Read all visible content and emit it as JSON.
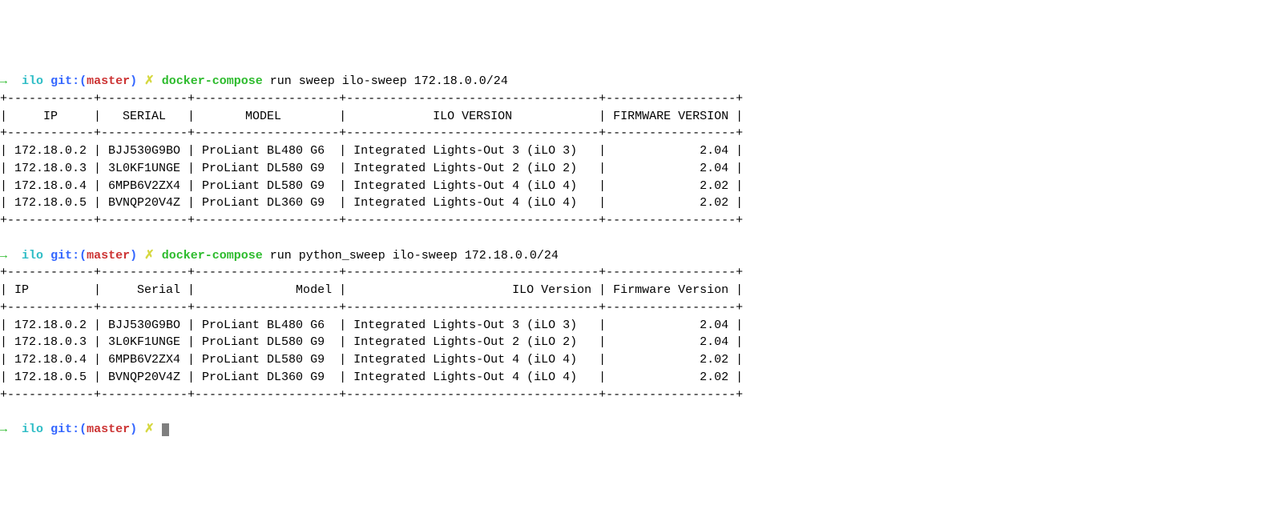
{
  "prompts": [
    {
      "arrow": "→",
      "dir": "ilo",
      "git_label": "git:(",
      "branch": "master",
      "git_close": ")",
      "x": "✗",
      "cmd": "docker-compose",
      "args": "run sweep ilo-sweep 172.18.0.0/24"
    },
    {
      "arrow": "→",
      "dir": "ilo",
      "git_label": "git:(",
      "branch": "master",
      "git_close": ")",
      "x": "✗",
      "cmd": "docker-compose",
      "args": "run python_sweep ilo-sweep 172.18.0.0/24"
    },
    {
      "arrow": "→",
      "dir": "ilo",
      "git_label": "git:(",
      "branch": "master",
      "git_close": ")",
      "x": "✗",
      "cmd": "",
      "args": ""
    }
  ],
  "tables": [
    {
      "border_top": "+------------+------------+--------------------+-----------------------------------+------------------+",
      "header": "|     IP     |   SERIAL   |       MODEL        |            ILO VERSION            | FIRMWARE VERSION |",
      "border_mid": "+------------+------------+--------------------+-----------------------------------+------------------+",
      "rows": [
        "| 172.18.0.2 | BJJ530G9BO | ProLiant BL480 G6  | Integrated Lights-Out 3 (iLO 3)   |             2.04 |",
        "| 172.18.0.3 | 3L0KF1UNGE | ProLiant DL580 G9  | Integrated Lights-Out 2 (iLO 2)   |             2.04 |",
        "| 172.18.0.4 | 6MPB6V2ZX4 | ProLiant DL580 G9  | Integrated Lights-Out 4 (iLO 4)   |             2.02 |",
        "| 172.18.0.5 | BVNQP20V4Z | ProLiant DL360 G9  | Integrated Lights-Out 4 (iLO 4)   |             2.02 |"
      ],
      "border_bot": "+------------+------------+--------------------+-----------------------------------+------------------+"
    },
    {
      "border_top": "+------------+------------+--------------------+-----------------------------------+------------------+",
      "header": "| IP         |     Serial |              Model |                       ILO Version | Firmware Version |",
      "border_mid": "+------------+------------+--------------------+-----------------------------------+------------------+",
      "rows": [
        "| 172.18.0.2 | BJJ530G9BO | ProLiant BL480 G6  | Integrated Lights-Out 3 (iLO 3)   |             2.04 |",
        "| 172.18.0.3 | 3L0KF1UNGE | ProLiant DL580 G9  | Integrated Lights-Out 2 (iLO 2)   |             2.04 |",
        "| 172.18.0.4 | 6MPB6V2ZX4 | ProLiant DL580 G9  | Integrated Lights-Out 4 (iLO 4)   |             2.02 |",
        "| 172.18.0.5 | BVNQP20V4Z | ProLiant DL360 G9  | Integrated Lights-Out 4 (iLO 4)   |             2.02 |"
      ],
      "border_bot": "+------------+------------+--------------------+-----------------------------------+------------------+"
    }
  ]
}
